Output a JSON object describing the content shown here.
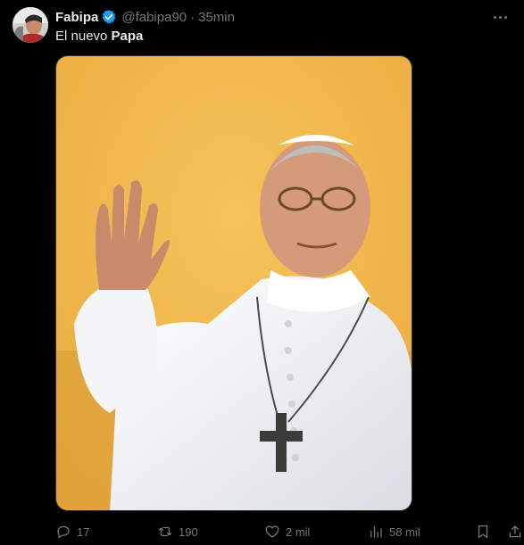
{
  "author": {
    "display_name": "Fabipa",
    "handle": "@fabipa90",
    "separator": "·",
    "time": "35min",
    "verified": true
  },
  "tweet": {
    "text_prefix": "El nuevo ",
    "text_bold": "Papa"
  },
  "actions": {
    "replies": "17",
    "retweets": "190",
    "likes": "2 mil",
    "views": "58 mil"
  },
  "colors": {
    "background": "#000000",
    "text": "#e7e9ea",
    "muted": "#71767b",
    "verified_blue": "#1d9bf0",
    "photo_backdrop": "#f0b64a"
  },
  "icons": {
    "verified": "verified-badge-icon",
    "more": "more-icon",
    "reply": "reply-icon",
    "retweet": "retweet-icon",
    "like": "heart-icon",
    "views": "views-chart-icon",
    "bookmark": "bookmark-icon",
    "share": "share-icon"
  }
}
